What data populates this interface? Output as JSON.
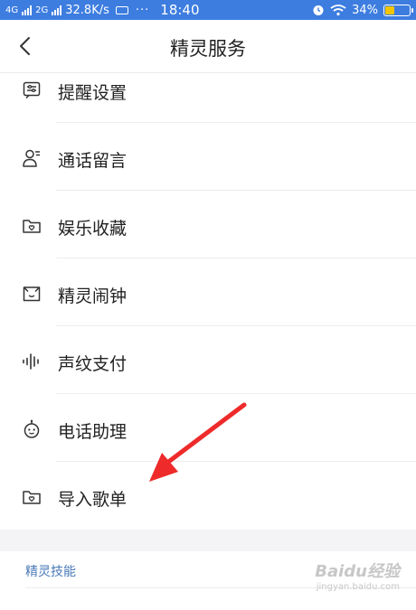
{
  "status_bar": {
    "network1": "4G",
    "network2": "2G",
    "speed": "32.8K/s",
    "dots": "···",
    "time": "18:40",
    "battery_text": "34%",
    "battery_level": 0.34,
    "battery_color": "#f3c400",
    "bar_color": "#3d7de0"
  },
  "header": {
    "back_icon": "chevron-left-icon",
    "title": "精灵服务"
  },
  "menu": {
    "items": [
      {
        "label": "提醒设置",
        "icon": "reminder-settings-icon"
      },
      {
        "label": "通话留言",
        "icon": "person-message-icon"
      },
      {
        "label": "娱乐收藏",
        "icon": "folder-heart-icon"
      },
      {
        "label": "精灵闹钟",
        "icon": "alarm-box-icon"
      },
      {
        "label": "声纹支付",
        "icon": "voiceprint-icon"
      },
      {
        "label": "电话助理",
        "icon": "robot-face-icon"
      },
      {
        "label": "导入歌单",
        "icon": "folder-heart-icon"
      }
    ]
  },
  "section": {
    "title": "精灵技能"
  },
  "watermark": {
    "line1": "Baidu经验",
    "line2": "jingyan.baidu.com"
  },
  "annotation": {
    "arrow_color": "#ee2a2a"
  }
}
